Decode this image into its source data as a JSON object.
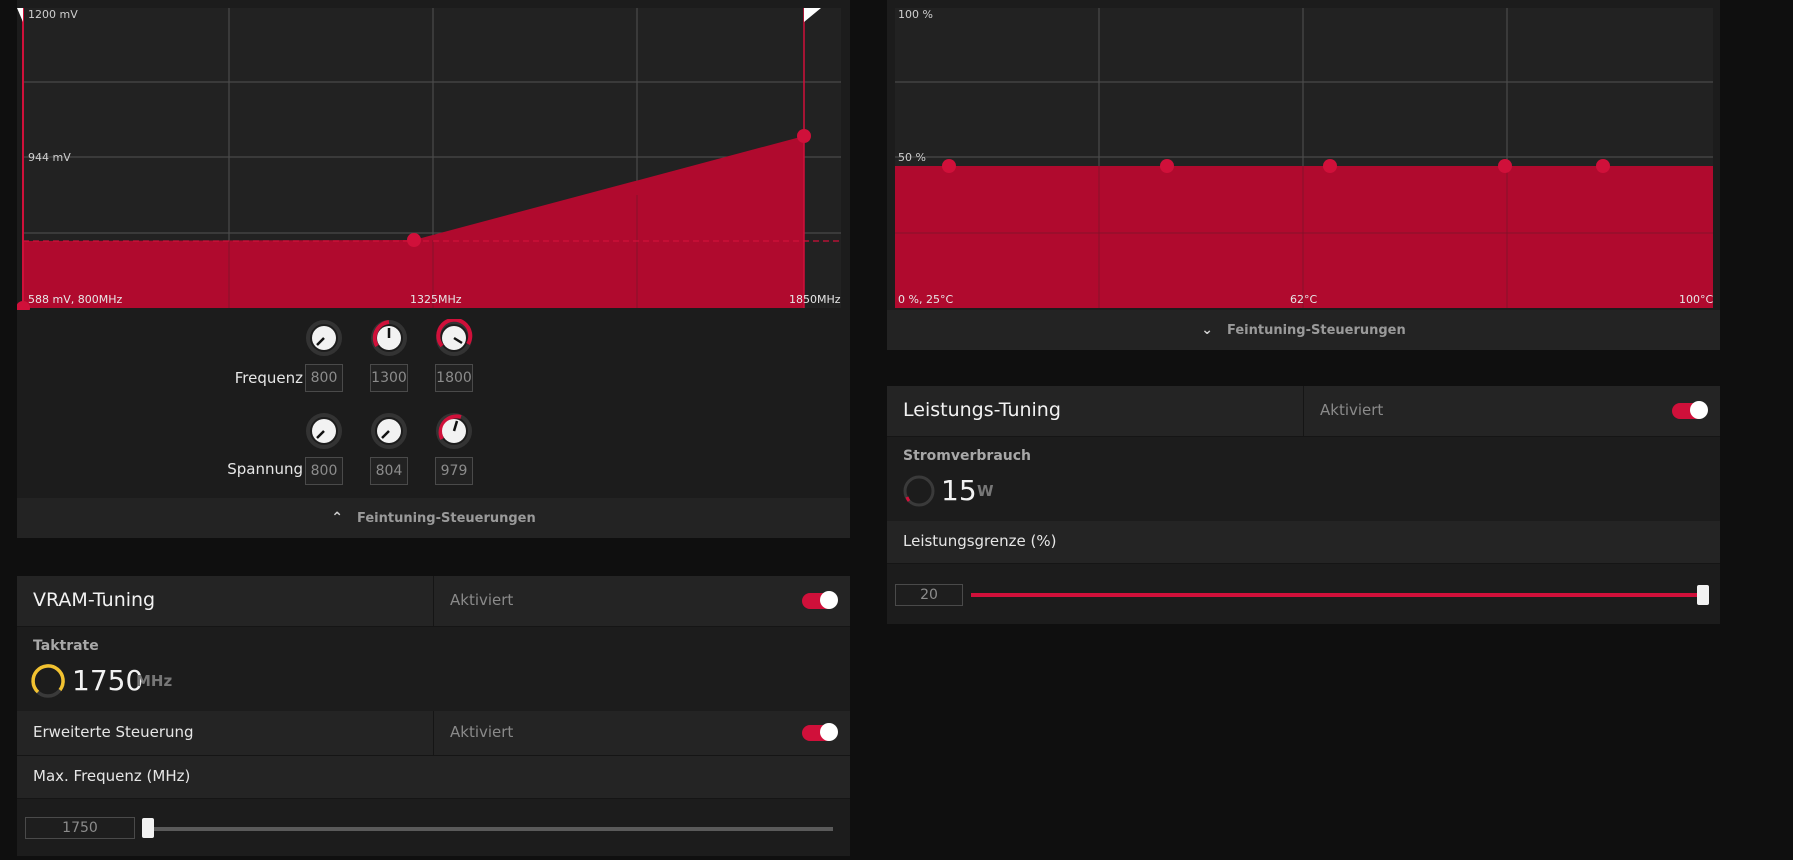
{
  "freq_curve": {
    "y_labels": [
      "1200 mV",
      "944 mV"
    ],
    "x_labels": [
      "588 mV, 800MHz",
      "1325MHz",
      "1850MHz"
    ],
    "accent": "#d0103a",
    "knob_row_freq_label": "Frequenz",
    "knob_row_volt_label": "Spannung",
    "freq_values": [
      "800",
      "1300",
      "1800"
    ],
    "volt_values": [
      "800",
      "804",
      "979"
    ],
    "footer_label": "Feintuning-Steuerungen"
  },
  "fan_curve": {
    "y_labels": [
      "100 %",
      "50 %"
    ],
    "x_labels": [
      "0 %, 25°C",
      "62°C",
      "100°C"
    ],
    "footer_label": "Feintuning-Steuerungen"
  },
  "power_tuning": {
    "title": "Leistungs-Tuning",
    "status": "Aktiviert",
    "consumption_label": "Stromverbrauch",
    "consumption_value": "15",
    "consumption_unit": "W",
    "limit_label": "Leistungsgrenze (%)",
    "limit_value": "20",
    "limit_fill_fraction": 1.0
  },
  "vram_tuning": {
    "title": "VRAM-Tuning",
    "status": "Aktiviert",
    "clock_label": "Taktrate",
    "clock_value": "1750",
    "clock_unit": "MHz",
    "advanced_label": "Erweiterte Steuerung",
    "advanced_status": "Aktiviert",
    "max_freq_label": "Max. Frequenz (MHz)",
    "max_freq_value": "1750",
    "max_freq_fill_fraction": 0.0
  }
}
